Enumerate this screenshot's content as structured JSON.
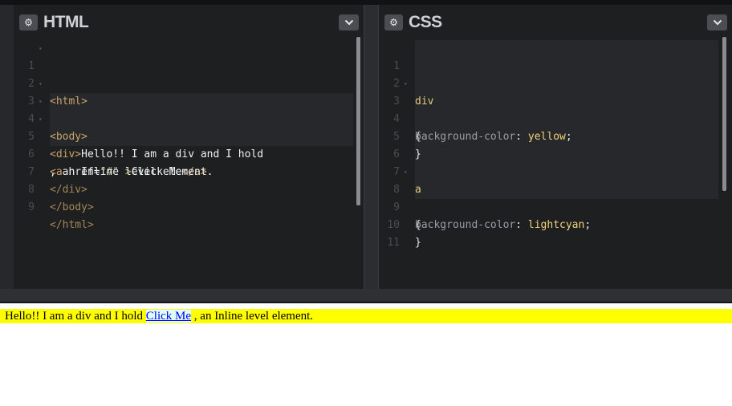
{
  "html_panel": {
    "title": "HTML",
    "settings_icon": "gear-icon",
    "collapse_icon": "chevron-down-icon",
    "line_numbers": [
      "1",
      "2",
      "3",
      "4",
      "5",
      "6",
      "7",
      "8",
      "9"
    ],
    "code": {
      "l1": "<html>",
      "l3": "<body>",
      "l4_tag": "<div>",
      "l4_text": "Hello!! I am a div and I hold",
      "l5_tag_open": "<a ",
      "l5_attr": "href=",
      "l5_str": "\"#\"",
      "l5_tag_close": " >",
      "l5_text": "Click Me",
      "l5_end_tag": "</a>",
      "l6_text": ", an Inline level element.",
      "l7": "</div>",
      "l8": "</body>",
      "l9": "</html>"
    }
  },
  "css_panel": {
    "title": "CSS",
    "settings_icon": "gear-icon",
    "collapse_icon": "chevron-down-icon",
    "line_numbers": [
      "1",
      "2",
      "3",
      "4",
      "5",
      "6",
      "7",
      "8",
      "9",
      "10",
      "11"
    ],
    "code": {
      "l2": "div",
      "l3": "{",
      "l4_prop": "background-color",
      "l4_colon": ": ",
      "l4_val": "yellow",
      "l4_semi": ";",
      "l5": "}",
      "l7": "a",
      "l8": "{",
      "l9_prop": "background-color",
      "l9_colon": ": ",
      "l9_val": "lightcyan",
      "l9_semi": ";",
      "l10": "}"
    }
  },
  "output": {
    "div_text_before": "Hello!! I am a div and I hold ",
    "link_text": "Click Me",
    "div_text_after": " , an Inline level element.",
    "div_background": "#ffff00",
    "link_background": "#e0ffff",
    "link_color": "#0000ee"
  }
}
